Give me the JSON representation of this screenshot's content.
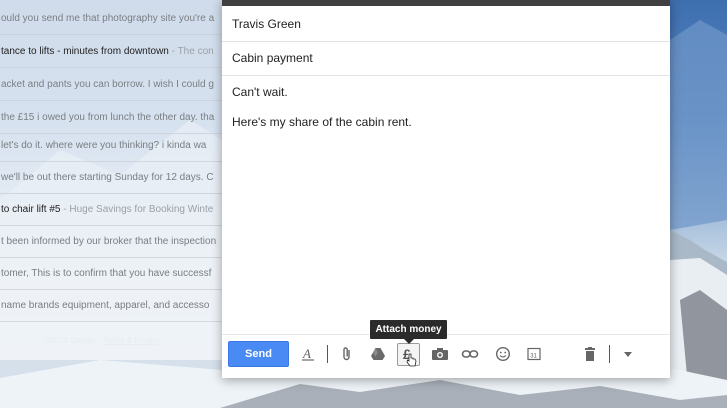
{
  "inbox": {
    "rows": [
      {
        "subject": "ould you send me that photography site you're a",
        "snippet": "",
        "unread": false
      },
      {
        "subject": "tance to lifts - minutes from downtown",
        "snippet": " - The con",
        "unread": true
      },
      {
        "subject": "acket and pants you can borrow. I wish I could g",
        "snippet": "",
        "unread": false
      },
      {
        "subject": "the £15 i owed you from lunch the other day. tha",
        "snippet": "",
        "unread": false
      },
      {
        "subject": " let's do it. where were you thinking? i kinda wa",
        "snippet": "",
        "unread": false
      },
      {
        "subject": "we'll be out there starting Sunday for 12 days. C",
        "snippet": "",
        "unread": false
      },
      {
        "subject": "to chair lift #5",
        "snippet": " - Huge Savings for Booking Winte",
        "unread": true
      },
      {
        "subject": "t been informed by our broker that the inspection",
        "snippet": "",
        "unread": false
      },
      {
        "subject": "tomer, This is to confirm that you have successf",
        "snippet": "",
        "unread": false
      },
      {
        "subject": "name brands equipment, apparel, and accesso",
        "snippet": "",
        "unread": false
      }
    ],
    "footer_copyright": "©2013 Google - ",
    "footer_link": "Terms & Privacy"
  },
  "compose": {
    "to": "Travis Green",
    "subject": "Cabin payment",
    "body_line1": "Can't wait.",
    "body_line2": "Here's my share of the cabin rent."
  },
  "toolbar": {
    "send_label": "Send",
    "tooltip": "Attach money",
    "icons": [
      "format-text-icon",
      "attach-file-icon",
      "google-drive-icon",
      "attach-money-icon",
      "insert-photo-icon",
      "insert-link-icon",
      "emoji-icon",
      "calendar-icon",
      "trash-icon",
      "more-options-icon"
    ],
    "calendar_day": "31"
  },
  "colors": {
    "send_button": "#4a8af4",
    "tooltip_bg": "#2b2b2b",
    "compose_topbar": "#404040"
  }
}
